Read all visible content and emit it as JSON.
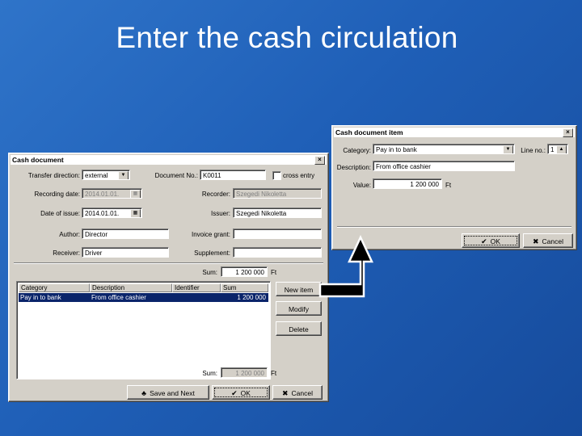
{
  "slide": {
    "title": "Enter the cash circulation"
  },
  "cash_document": {
    "title": "Cash document",
    "close": "×",
    "transfer_direction_label": "Transfer direction:",
    "transfer_direction_value": "external",
    "document_no_label": "Document No.:",
    "document_no_value": "K0011",
    "cross_entry_label": "cross entry",
    "recording_date_label": "Recording date:",
    "recording_date_value": "2014.01.01.",
    "recorder_label": "Recorder:",
    "recorder_value": "Szegedi Nikoletta",
    "date_of_issue_label": "Date of issue:",
    "date_of_issue_value": "2014.01.01.",
    "issuer_label": "Issuer:",
    "issuer_value": "Szegedi Nikoletta",
    "author_label": "Author:",
    "author_value": "Director",
    "invoice_grant_label": "Invoice grant:",
    "invoice_grant_value": "",
    "receiver_label": "Receiver:",
    "receiver_value": "Driver",
    "supplement_label": "Supplement:",
    "supplement_value": "",
    "sum_label": "Sum:",
    "sum_value": "1 200 000",
    "currency": "Ft",
    "table": {
      "headers": [
        "Category",
        "Description",
        "Identifier",
        "Sum"
      ],
      "rows": [
        [
          "Pay in to bank",
          "From office cashier",
          "",
          "1 200 000"
        ]
      ]
    },
    "new_item_label": "New item",
    "modify_label": "Modify",
    "delete_label": "Delete",
    "bottom_sum_label": "Sum:",
    "bottom_sum_value": "1 200 000",
    "bottom_currency": "Ft",
    "save_and_next_label": "Save and Next",
    "ok_label": "OK",
    "cancel_label": "Cancel"
  },
  "cash_item": {
    "title": "Cash document item",
    "close": "×",
    "category_label": "Category:",
    "category_value": "Pay in to bank",
    "line_label": "Line no.:",
    "line_value": "1",
    "description_label": "Description:",
    "description_value": "From office cashier",
    "value_label": "Value:",
    "value_value": "1 200 000",
    "currency": "Ft",
    "ok_label": "OK",
    "cancel_label": "Cancel"
  },
  "colors": {
    "background": "#1f5fb7",
    "selection": "#0a246a",
    "arrow": "#000000"
  }
}
